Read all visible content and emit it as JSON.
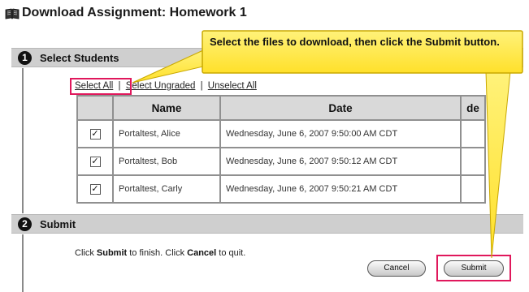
{
  "page": {
    "title": "Download Assignment: Homework 1"
  },
  "step1": {
    "number": "1",
    "label": "Select Students"
  },
  "select_links": {
    "select_all": "Select All",
    "select_ungraded": "Select Ungraded",
    "separator": "|",
    "unselect_all": "Unselect All"
  },
  "table": {
    "headers": {
      "check": "",
      "name": "Name",
      "date": "Date",
      "grade": "de"
    },
    "rows": [
      {
        "checked": "✓",
        "name": "Portaltest, Alice",
        "date": "Wednesday, June 6, 2007 9:50:00 AM CDT"
      },
      {
        "checked": "✓",
        "name": "Portaltest, Bob",
        "date": "Wednesday, June 6, 2007 9:50:12 AM CDT"
      },
      {
        "checked": "✓",
        "name": "Portaltest, Carly",
        "date": "Wednesday, June 6, 2007 9:50:21 AM CDT"
      }
    ]
  },
  "step2": {
    "number": "2",
    "label": "Submit"
  },
  "instruction": {
    "prefix": "Click ",
    "submit_word": "Submit",
    "middle": " to finish. Click ",
    "cancel_word": "Cancel",
    "suffix": " to quit."
  },
  "buttons": {
    "cancel": "Cancel",
    "submit": "Submit"
  },
  "callout": {
    "text": "Select the files to download, then click the Submit button."
  },
  "colors": {
    "highlight": "#e0185c",
    "callout_fill": "#ffea3d",
    "header_bg": "#cfcfcf"
  },
  "icons": {
    "title_icon": "book-icon",
    "checkbox": "checkmark"
  }
}
